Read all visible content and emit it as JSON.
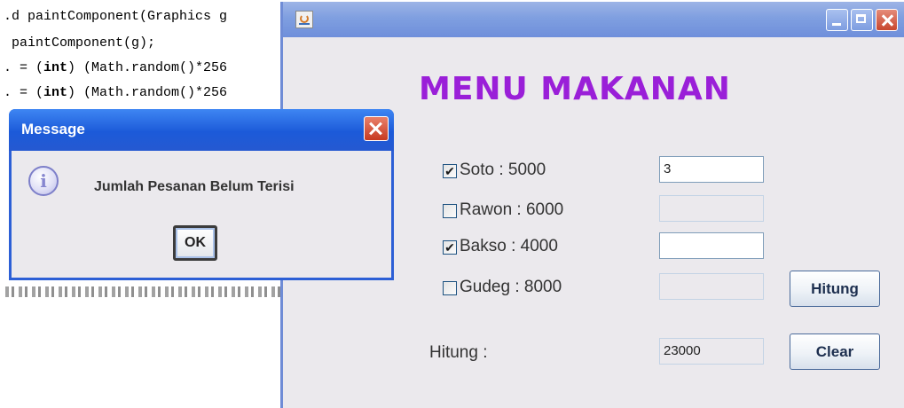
{
  "code_editor": {
    "lines": [
      ".d paintComponent(Graphics g",
      " paintComponent(g);",
      ". = (int) (Math.random()*256",
      ". = (int) (Math.random()*256"
    ],
    "keyword": "int"
  },
  "window": {
    "icon": "java-cup-icon",
    "controls": [
      "minimize-icon",
      "maximize-icon",
      "close-icon"
    ],
    "heading": "MENU MAKANAN",
    "heading_color": "#9a1fd8",
    "items": [
      {
        "label": "Soto : 5000",
        "checked": true,
        "value": "3",
        "enabled": true
      },
      {
        "label": "Rawon : 6000",
        "checked": false,
        "value": "",
        "enabled": false
      },
      {
        "label": "Bakso : 4000",
        "checked": true,
        "value": "",
        "enabled": true
      },
      {
        "label": "Gudeg : 8000",
        "checked": false,
        "value": "",
        "enabled": false
      }
    ],
    "total_label": "Hitung :",
    "total_value": "23000",
    "hitung_button": "Hitung",
    "clear_button": "Clear"
  },
  "dialog": {
    "title": "Message",
    "message": "Jumlah Pesanan Belum Terisi",
    "ok_button": "OK",
    "icon": "info-icon",
    "title_color": "#1c5ad9"
  }
}
